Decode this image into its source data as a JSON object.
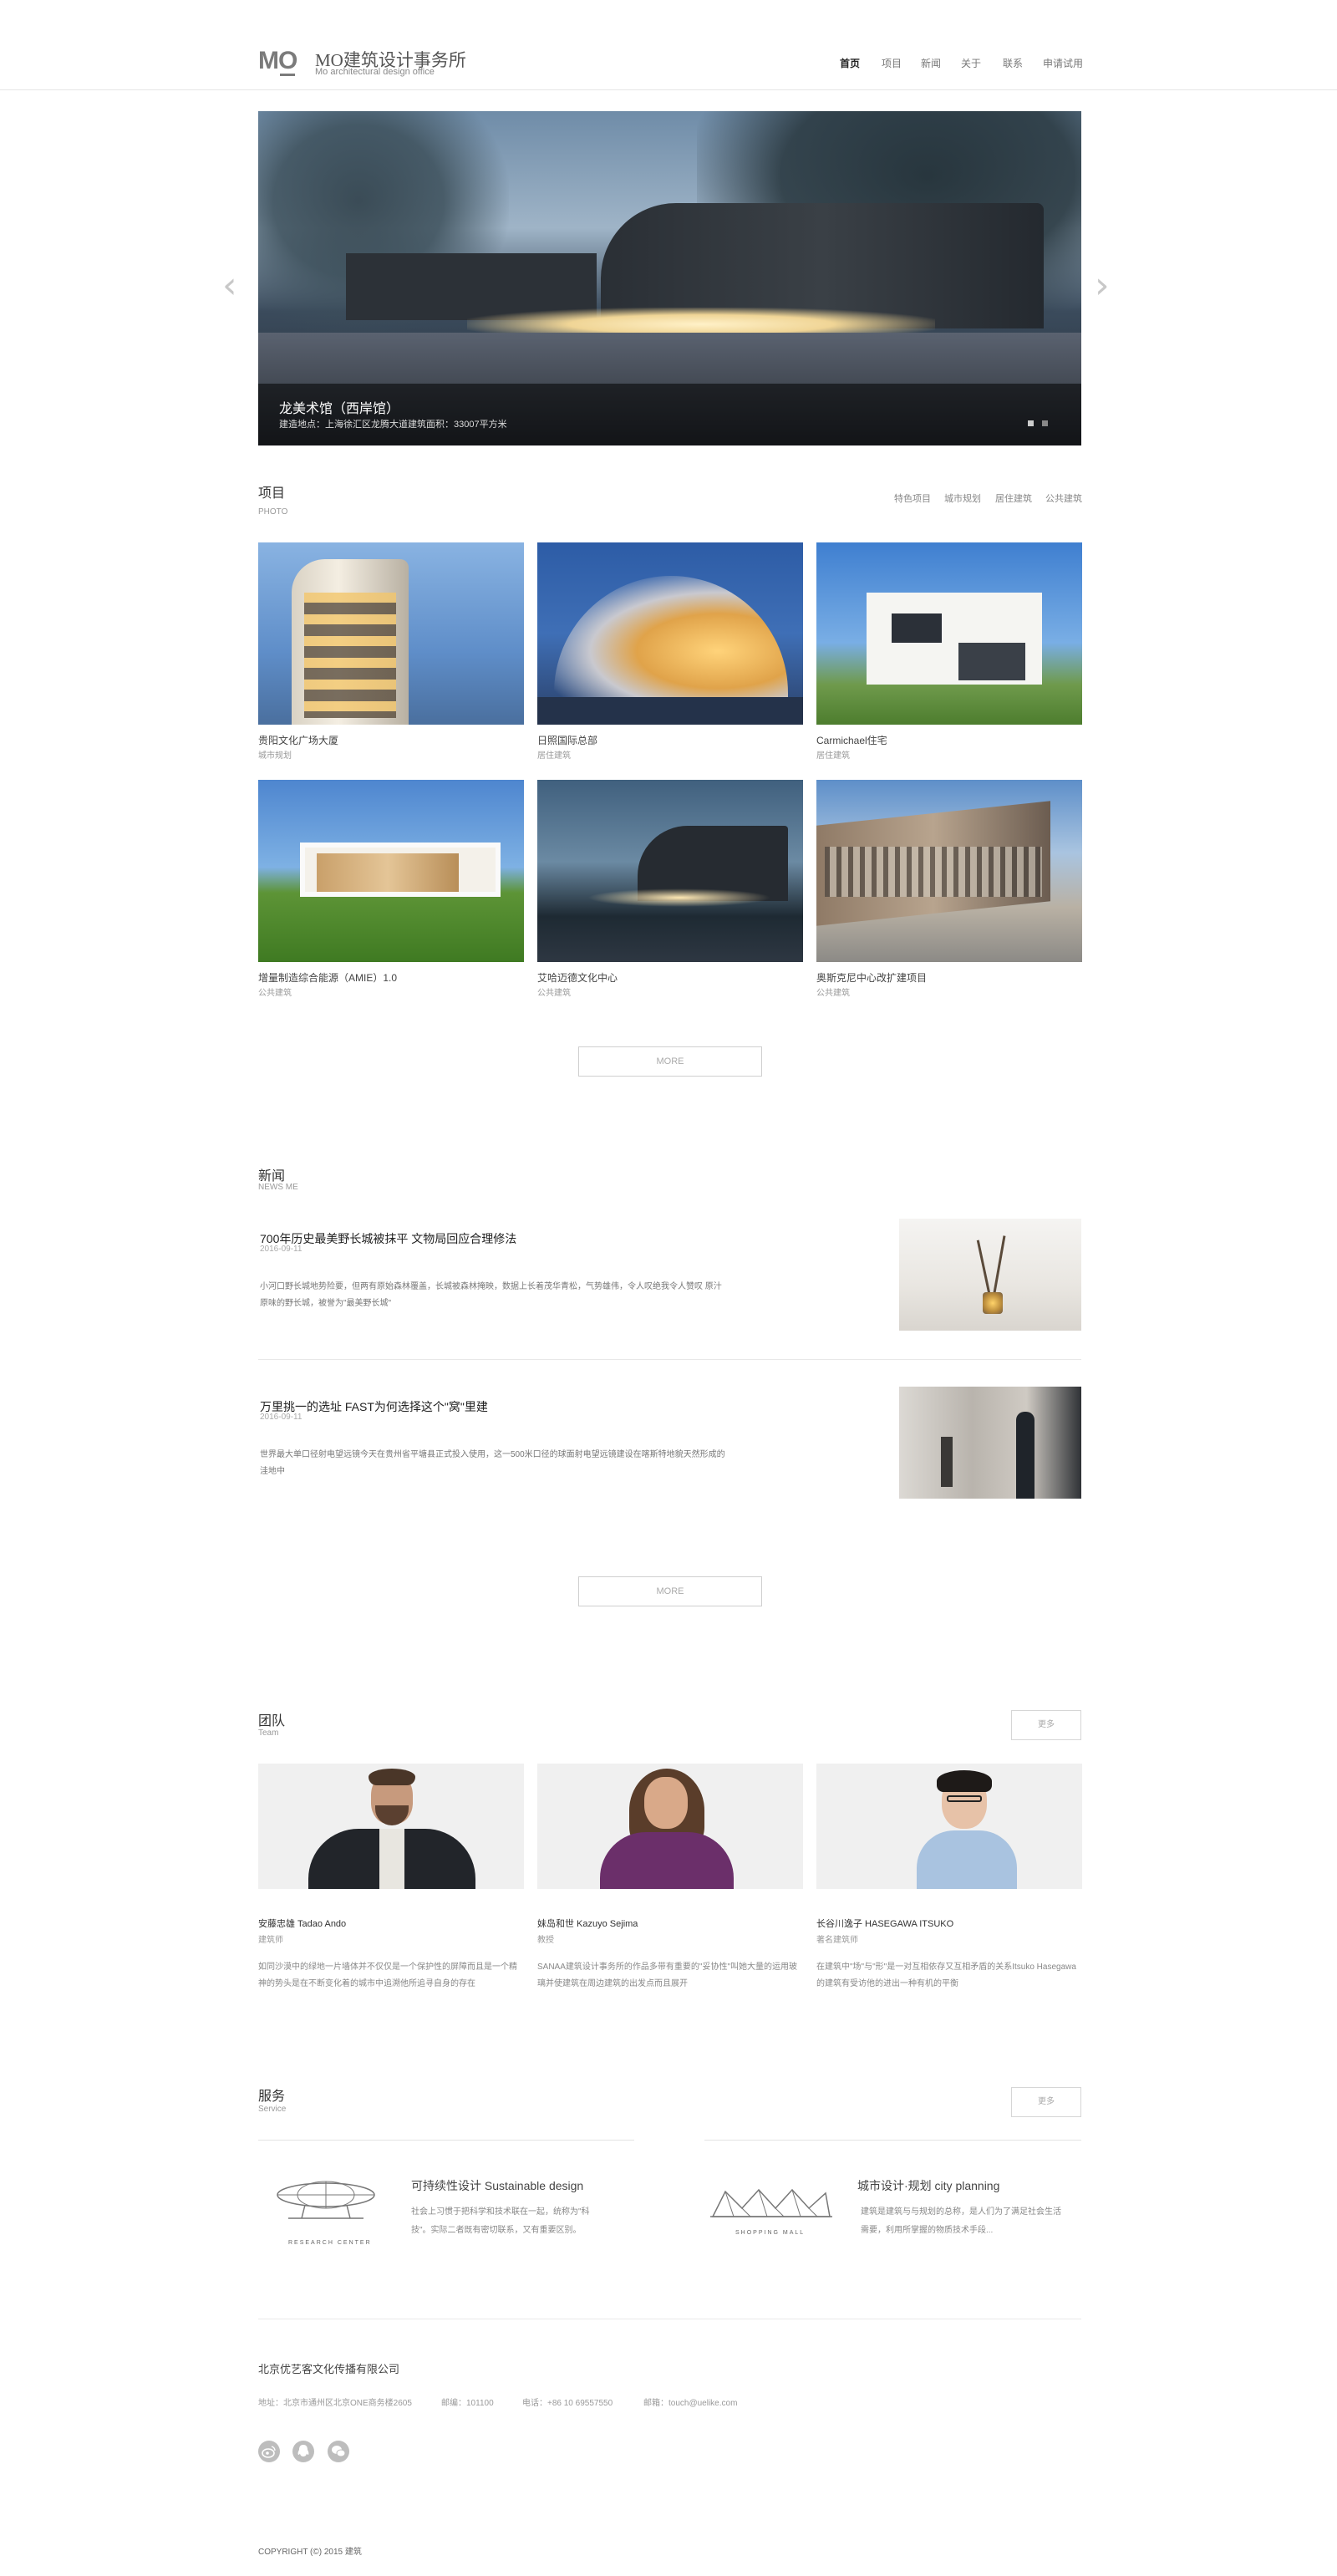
{
  "header": {
    "logo_mark": "MO",
    "brand_title": "MO建筑设计事务所",
    "brand_sub": "Mo architectural design office",
    "nav": [
      "首页",
      "项目",
      "新闻",
      "关于",
      "联系",
      "申请试用"
    ]
  },
  "hero": {
    "title": "龙美术馆（西岸馆）",
    "subtitle": "建造地点：上海徐汇区龙腾大道建筑面积：33007平方米",
    "slides": 2,
    "active_slide": 1
  },
  "projects": {
    "title": "项目",
    "subtitle": "PHOTO",
    "filters": [
      "特色项目",
      "城市规划",
      "居住建筑",
      "公共建筑"
    ],
    "items": [
      {
        "name": "贵阳文化广场大厦",
        "category": "城市规划"
      },
      {
        "name": "日照国际总部",
        "category": "居住建筑"
      },
      {
        "name": "Carmichael住宅",
        "category": "居住建筑"
      },
      {
        "name": "增量制造综合能源（AMIE）1.0",
        "category": "公共建筑"
      },
      {
        "name": "艾哈迈德文化中心",
        "category": "公共建筑"
      },
      {
        "name": "奥斯克尼中心改扩建项目",
        "category": "公共建筑"
      }
    ],
    "more_label": "MORE"
  },
  "news": {
    "title": "新闻",
    "subtitle": "NEWS ME",
    "items": [
      {
        "title": "700年历史最美野长城被抹平 文物局回应合理修法",
        "date": "2016-09-11",
        "body": "小河口野长城地势险要，但两有原始森林覆盖，长城被森林掩映，数据上长着茂华青松，气势雄伟，令人叹绝我令人赞叹 原汁原味的野长城，被誉为\"最美野长城\""
      },
      {
        "title": "万里挑一的选址 FAST为何选择这个\"窝\"里建",
        "date": "2016-09-11",
        "body": "世界最大单口径射电望远镜今天在贵州省平塘县正式投入使用，这一500米口径的球面射电望远镜建设在喀斯特地貌天然形成的洼地中"
      }
    ],
    "more_label": "MORE"
  },
  "team": {
    "title": "团队",
    "subtitle": "Team",
    "more_label": "更多",
    "members": [
      {
        "name": "安藤忠雄 Tadao Ando",
        "role": "建筑师",
        "desc": "如同沙漠中的绿地一片墙体并不仅仅是一个保护性的屏障而且是一个精神的势头是在不断变化着的城市中追溯他所追寻自身的存在"
      },
      {
        "name": "妹岛和世 Kazuyo Sejima",
        "role": "教授",
        "desc": "SANAA建筑设计事务所的作品多带有重要的\"妥协性\"叫她大量的运用玻璃并使建筑在周边建筑的出发点而且展开"
      },
      {
        "name": "长谷川逸子 HASEGAWA ITSUKO",
        "role": "著名建筑师",
        "desc": "在建筑中\"场\"与\"形\"是一对互相依存又互相矛盾的关系Itsuko Hasegawa的建筑有受访他的进出一种有机的平衡"
      }
    ]
  },
  "services": {
    "title": "服务",
    "subtitle": "Service",
    "more_label": "更多",
    "items": [
      {
        "title": "可持续性设计 Sustainable design",
        "desc": "社会上习惯于把科学和技术联在一起，统称为\"科技\"。实际二者既有密切联系，又有重要区别。",
        "icon": "research-center-icon",
        "caption": "RESEARCH CENTER"
      },
      {
        "title": "城市设计·规划 city planning",
        "desc": "建筑是建筑与与规划的总称，是人们为了满足社会生活需要，利用所掌握的物质技术手段...",
        "icon": "shopping-mall-icon",
        "caption": "SHOPPING MALL"
      }
    ]
  },
  "footer": {
    "company": "北京优艺客文化传播有限公司",
    "address": "地址：北京市通州区北京ONE商务楼2605",
    "postcode": "邮编：101100",
    "phone": "电话：+86 10 69557550",
    "email": "邮箱：touch@uelike.com",
    "social": [
      "weibo-icon",
      "qq-icon",
      "wechat-icon"
    ],
    "copyright": "COPYRIGHT (©) 2015 建筑"
  }
}
